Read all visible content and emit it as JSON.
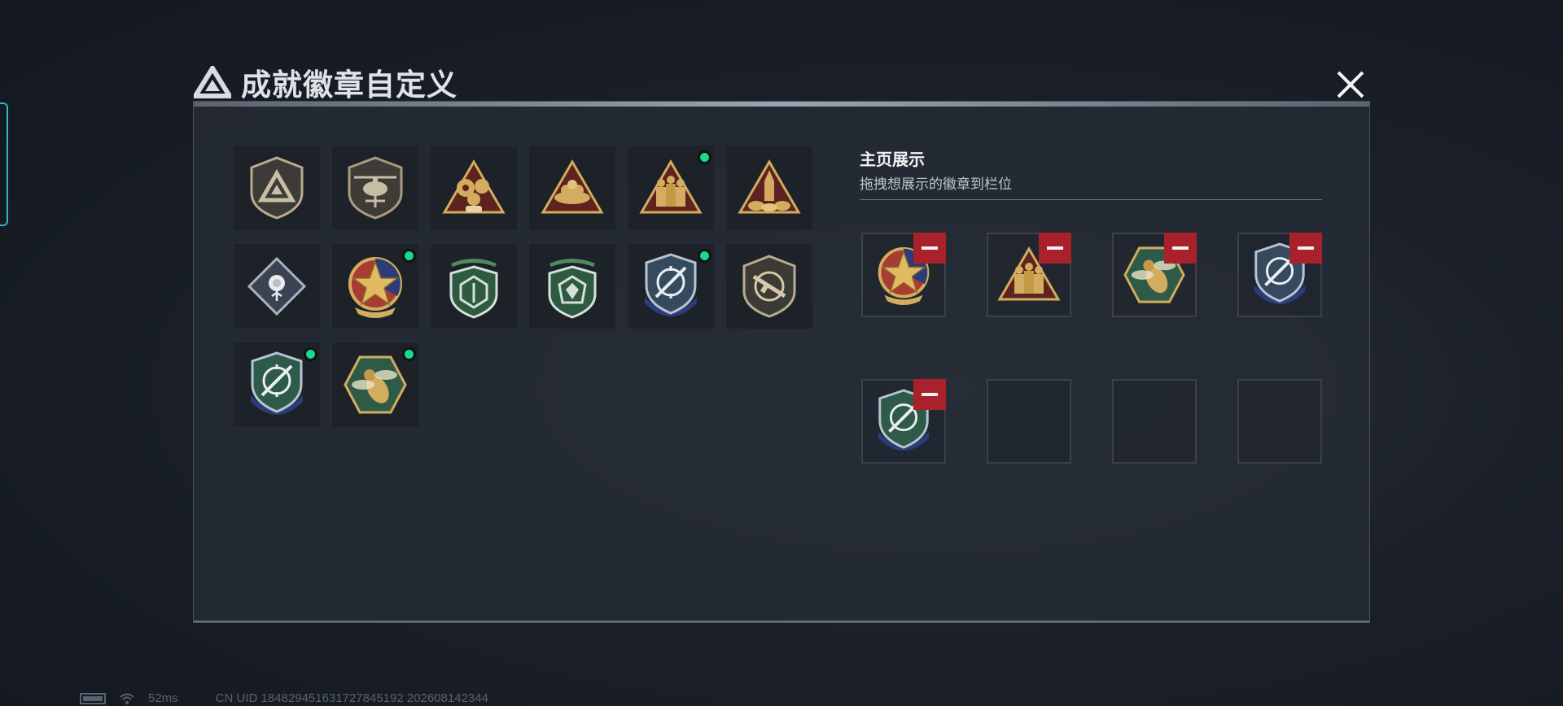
{
  "dialog": {
    "title": "成就徽章自定义",
    "title_icon": "triangle-logo-icon",
    "close_icon": "close-icon"
  },
  "badges": [
    {
      "icon": "triangle-logo-shield-badge",
      "new": false
    },
    {
      "icon": "helicopter-shield-badge",
      "new": false
    },
    {
      "icon": "gears-triangle-badge",
      "new": false
    },
    {
      "icon": "nest-triangle-badge",
      "new": false
    },
    {
      "icon": "soldiers-triangle-badge",
      "new": true
    },
    {
      "icon": "rocket-triangle-badge",
      "new": false
    },
    {
      "icon": "rose-diamond-badge",
      "new": false
    },
    {
      "icon": "star-emblem-badge",
      "new": true
    },
    {
      "icon": "green-shield-badge",
      "new": false
    },
    {
      "icon": "green-gem-shield-badge",
      "new": false
    },
    {
      "icon": "blue-crosshair-shield-badge",
      "new": true
    },
    {
      "icon": "rifle-shield-badge",
      "new": false
    },
    {
      "icon": "blue-crosshair-shield-badge-2",
      "new": true
    },
    {
      "icon": "wasp-hexagon-badge",
      "new": true
    }
  ],
  "showcase": {
    "title": "主页展示",
    "subtitle": "拖拽想展示的徽章到栏位",
    "slots": [
      {
        "icon": "star-emblem-badge",
        "filled": true
      },
      {
        "icon": "soldiers-triangle-badge",
        "filled": true
      },
      {
        "icon": "wasp-hexagon-badge",
        "filled": true
      },
      {
        "icon": "blue-crosshair-shield-badge",
        "filled": true
      },
      {
        "icon": "blue-crosshair-shield-badge",
        "filled": true
      },
      {
        "icon": "",
        "filled": false
      },
      {
        "icon": "",
        "filled": false
      },
      {
        "icon": "",
        "filled": false
      }
    ]
  },
  "status_bar": {
    "ping": "52ms",
    "uid": "CN UID 184829451631727845192 202608142344"
  },
  "colors": {
    "accent_cyan": "#2fb7c8",
    "new_dot": "#19d98a",
    "remove_red": "#a8212b",
    "badge_gold": "#d2ad5f",
    "badge_green": "#3e6e52",
    "badge_blue": "#2c3c78"
  }
}
